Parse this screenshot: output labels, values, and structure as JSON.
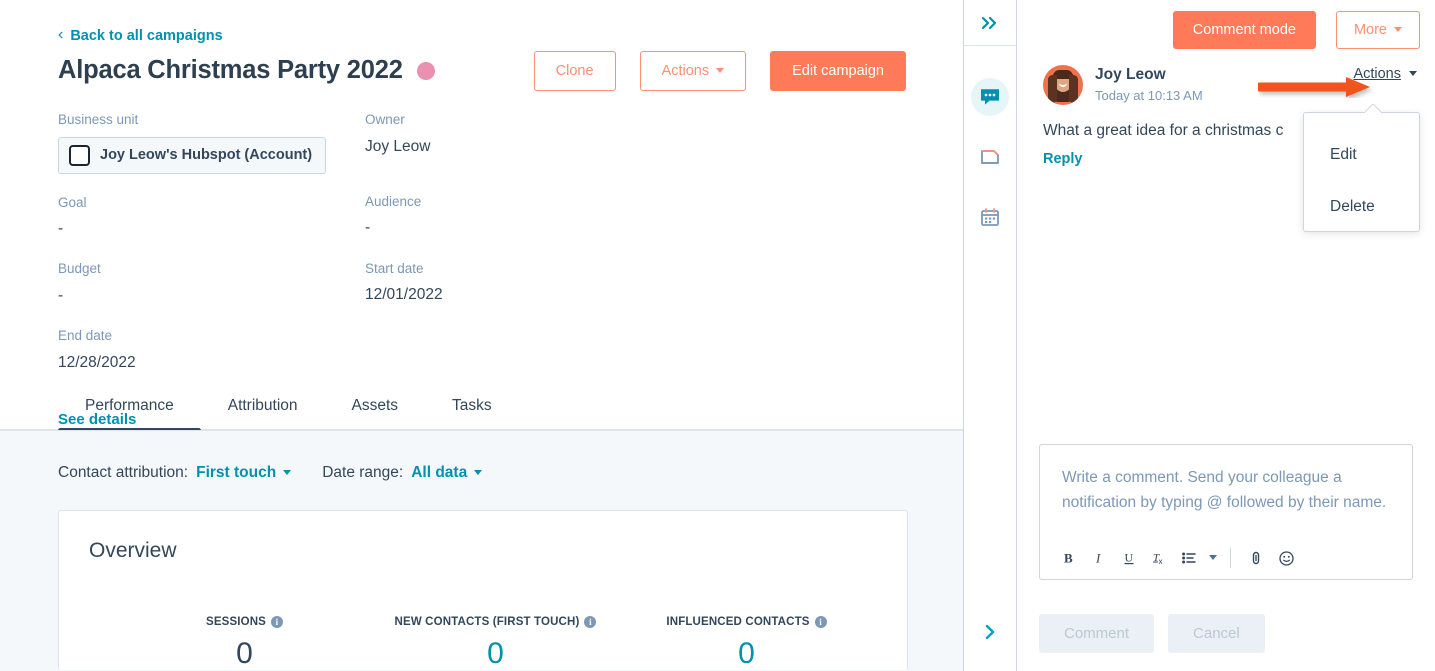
{
  "campaign": {
    "back_link": "Back to all campaigns",
    "title": "Alpaca Christmas Party 2022",
    "color_dot": "#ea90b1",
    "buttons": {
      "clone": "Clone",
      "actions": "Actions",
      "edit": "Edit campaign"
    },
    "details": [
      {
        "label": "Business unit",
        "value": "Joy Leow's Hubspot (Account)",
        "is_chip": true
      },
      {
        "label": "Owner",
        "value": "Joy Leow"
      },
      {
        "label": "Goal",
        "value": "-"
      },
      {
        "label": "Audience",
        "value": "-"
      },
      {
        "label": "Budget",
        "value": "-"
      },
      {
        "label": "Start date",
        "value": "12/01/2022"
      },
      {
        "label": "End date",
        "value": "12/28/2022"
      }
    ],
    "see_details": "See details"
  },
  "tabs": [
    {
      "label": "Performance",
      "active": true
    },
    {
      "label": "Attribution",
      "active": false
    },
    {
      "label": "Assets",
      "active": false
    },
    {
      "label": "Tasks",
      "active": false
    }
  ],
  "filters": [
    {
      "label": "Contact attribution:",
      "value": "First touch"
    },
    {
      "label": "Date range:",
      "value": "All data"
    }
  ],
  "overview": {
    "title": "Overview",
    "metrics": [
      {
        "label": "SESSIONS",
        "value": "0",
        "color": "#33475b"
      },
      {
        "label": "NEW CONTACTS (FIRST TOUCH)",
        "value": "0",
        "color": "#0091ae"
      },
      {
        "label": "INFLUENCED CONTACTS",
        "value": "0",
        "color": "#0091ae"
      }
    ]
  },
  "icon_rail": {
    "top": "collapse-panel-icon",
    "items": [
      {
        "icon": "comment-icon",
        "active": true
      },
      {
        "icon": "notebook-icon",
        "active": false
      },
      {
        "icon": "calendar-icon",
        "active": false
      }
    ],
    "bottom": "expand-panel-icon"
  },
  "right_panel": {
    "header": {
      "comment_mode": "Comment mode",
      "more": "More"
    },
    "comment": {
      "author": "Joy Leow",
      "timestamp": "Today at 10:13 AM",
      "body": "What a great idea for a christmas c",
      "reply": "Reply",
      "actions_label": "Actions"
    },
    "dropdown": {
      "items": [
        "Edit",
        "Delete"
      ]
    },
    "editor": {
      "placeholder": "Write a comment. Send your colleague a notification by typing @ followed by their name.",
      "toolbar": [
        "bold-icon",
        "italic-icon",
        "underline-icon",
        "clear-format-icon",
        "bulleted-list-icon",
        "list-dropdown-caret-icon",
        "attachment-icon",
        "emoji-icon"
      ]
    },
    "footer": {
      "comment": "Comment",
      "cancel": "Cancel"
    }
  },
  "annotation": {
    "arrow_color": "#f2541b"
  }
}
